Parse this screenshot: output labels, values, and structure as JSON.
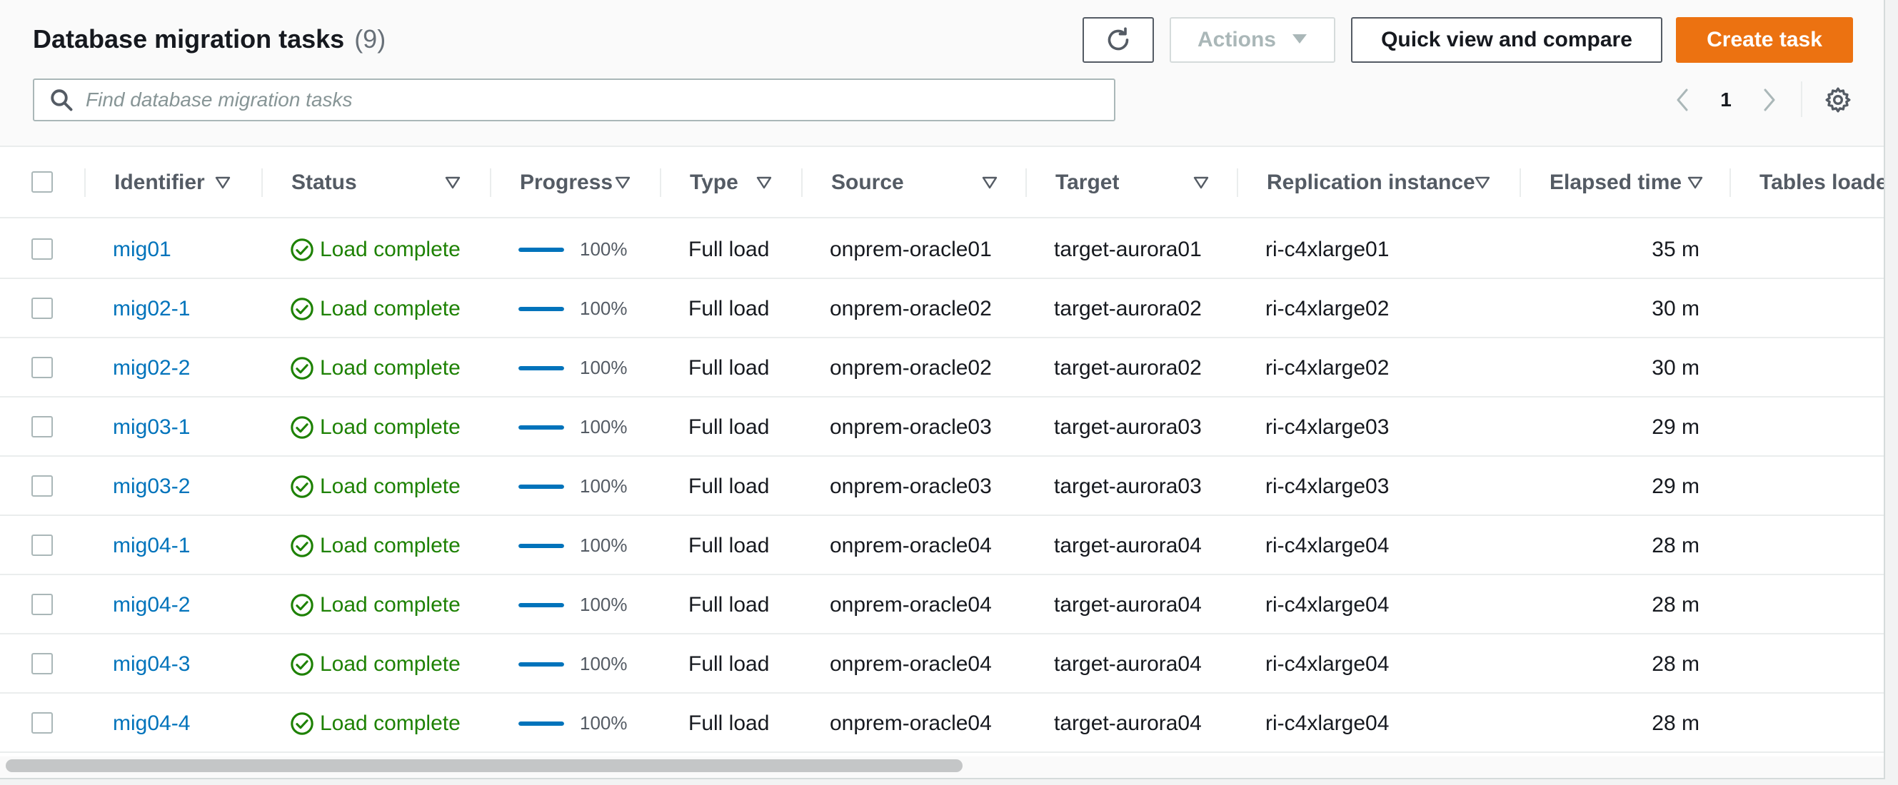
{
  "header": {
    "title": "Database migration tasks",
    "count": "(9)",
    "actions_label": "Actions",
    "quick_view_label": "Quick view and compare",
    "create_label": "Create task"
  },
  "search": {
    "placeholder": "Find database migration tasks"
  },
  "pagination": {
    "current_page": "1"
  },
  "columns": {
    "identifier": "Identifier",
    "status": "Status",
    "progress": "Progress",
    "type": "Type",
    "source": "Source",
    "target": "Target",
    "replication": "Replication instance",
    "elapsed": "Elapsed time",
    "tables": "Tables loaded"
  },
  "rows": [
    {
      "id": "mig01",
      "status": "Load complete",
      "progress": 1.0,
      "progress_label": "100%",
      "type": "Full load",
      "source": "onprem-oracle01",
      "target": "target-aurora01",
      "replication": "ri-c4xlarge01",
      "elapsed": "35 m"
    },
    {
      "id": "mig02-1",
      "status": "Load complete",
      "progress": 1.0,
      "progress_label": "100%",
      "type": "Full load",
      "source": "onprem-oracle02",
      "target": "target-aurora02",
      "replication": "ri-c4xlarge02",
      "elapsed": "30 m"
    },
    {
      "id": "mig02-2",
      "status": "Load complete",
      "progress": 1.0,
      "progress_label": "100%",
      "type": "Full load",
      "source": "onprem-oracle02",
      "target": "target-aurora02",
      "replication": "ri-c4xlarge02",
      "elapsed": "30 m"
    },
    {
      "id": "mig03-1",
      "status": "Load complete",
      "progress": 1.0,
      "progress_label": "100%",
      "type": "Full load",
      "source": "onprem-oracle03",
      "target": "target-aurora03",
      "replication": "ri-c4xlarge03",
      "elapsed": "29 m"
    },
    {
      "id": "mig03-2",
      "status": "Load complete",
      "progress": 1.0,
      "progress_label": "100%",
      "type": "Full load",
      "source": "onprem-oracle03",
      "target": "target-aurora03",
      "replication": "ri-c4xlarge03",
      "elapsed": "29 m"
    },
    {
      "id": "mig04-1",
      "status": "Load complete",
      "progress": 1.0,
      "progress_label": "100%",
      "type": "Full load",
      "source": "onprem-oracle04",
      "target": "target-aurora04",
      "replication": "ri-c4xlarge04",
      "elapsed": "28 m"
    },
    {
      "id": "mig04-2",
      "status": "Load complete",
      "progress": 1.0,
      "progress_label": "100%",
      "type": "Full load",
      "source": "onprem-oracle04",
      "target": "target-aurora04",
      "replication": "ri-c4xlarge04",
      "elapsed": "28 m"
    },
    {
      "id": "mig04-3",
      "status": "Load complete",
      "progress": 1.0,
      "progress_label": "100%",
      "type": "Full load",
      "source": "onprem-oracle04",
      "target": "target-aurora04",
      "replication": "ri-c4xlarge04",
      "elapsed": "28 m"
    },
    {
      "id": "mig04-4",
      "status": "Load complete",
      "progress": 1.0,
      "progress_label": "100%",
      "type": "Full load",
      "source": "onprem-oracle04",
      "target": "target-aurora04",
      "replication": "ri-c4xlarge04",
      "elapsed": "28 m"
    }
  ],
  "icons": {
    "refresh": "refresh-icon",
    "caret": "caret-down-icon",
    "search": "search-icon",
    "prev": "chevron-left-icon",
    "next": "chevron-right-icon",
    "settings": "gear-icon",
    "sort": "sort-caret-icon",
    "status_ok": "check-circle-icon"
  },
  "colors": {
    "primary_button": "#ec7211",
    "link": "#0073bb",
    "success": "#1d8102",
    "progress_fill": "#0073bb"
  }
}
